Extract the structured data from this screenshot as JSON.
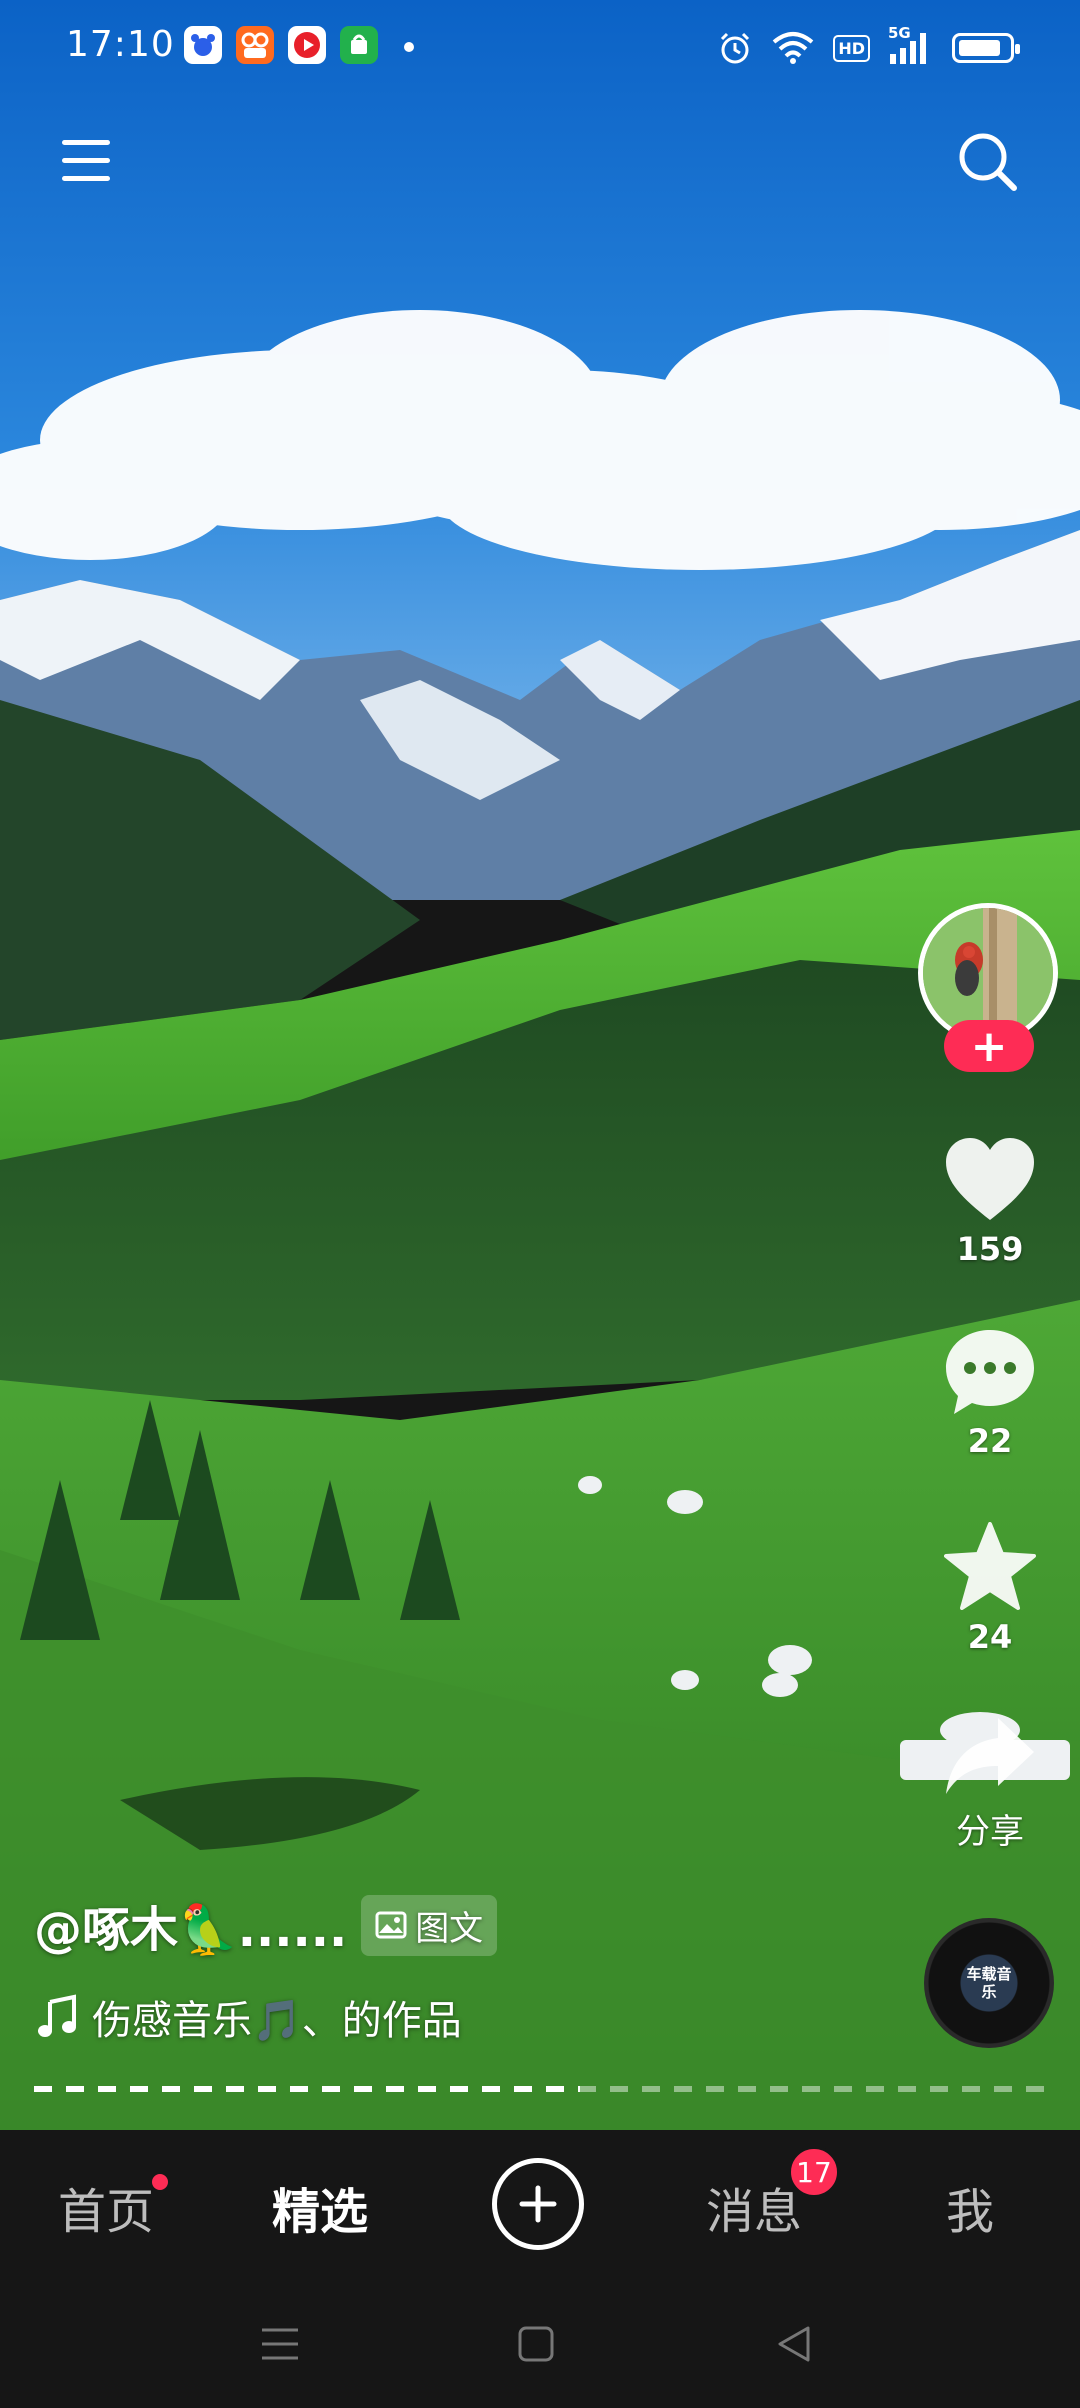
{
  "status_bar": {
    "time": "17:10",
    "app_icons": [
      {
        "name": "baidu-app-icon",
        "color": "#ffffff"
      },
      {
        "name": "kuaishou-app-icon",
        "color": "#ff6a1f"
      },
      {
        "name": "video-app-icon",
        "color": "#ffffff"
      },
      {
        "name": "shop-app-icon",
        "color": "#22b14c"
      }
    ],
    "network_label": "HD",
    "signal_label": "5G",
    "battery_level": 0.85
  },
  "top_bar": {
    "menu_icon": "menu-icon",
    "search_icon": "search-icon"
  },
  "rail": {
    "avatar_icon": "avatar-woodpecker-icon",
    "follow_label": "+",
    "like_count": "159",
    "comment_count": "22",
    "favorite_count": "24",
    "share_label": "分享"
  },
  "caption": {
    "author": "@啄木🦜......",
    "tag_label": "图文",
    "music_text": "伤感音乐🎵、的作品"
  },
  "music_disc": {
    "label": "车载音乐"
  },
  "progress": {
    "value": 0.54
  },
  "bottom_nav": {
    "tabs": [
      {
        "label": "首页",
        "active": false
      },
      {
        "label": "精选",
        "active": true
      },
      {
        "label": "消息",
        "active": false
      },
      {
        "label": "我",
        "active": false
      }
    ],
    "message_badge": "17",
    "accent_color": "#fe2c55"
  }
}
